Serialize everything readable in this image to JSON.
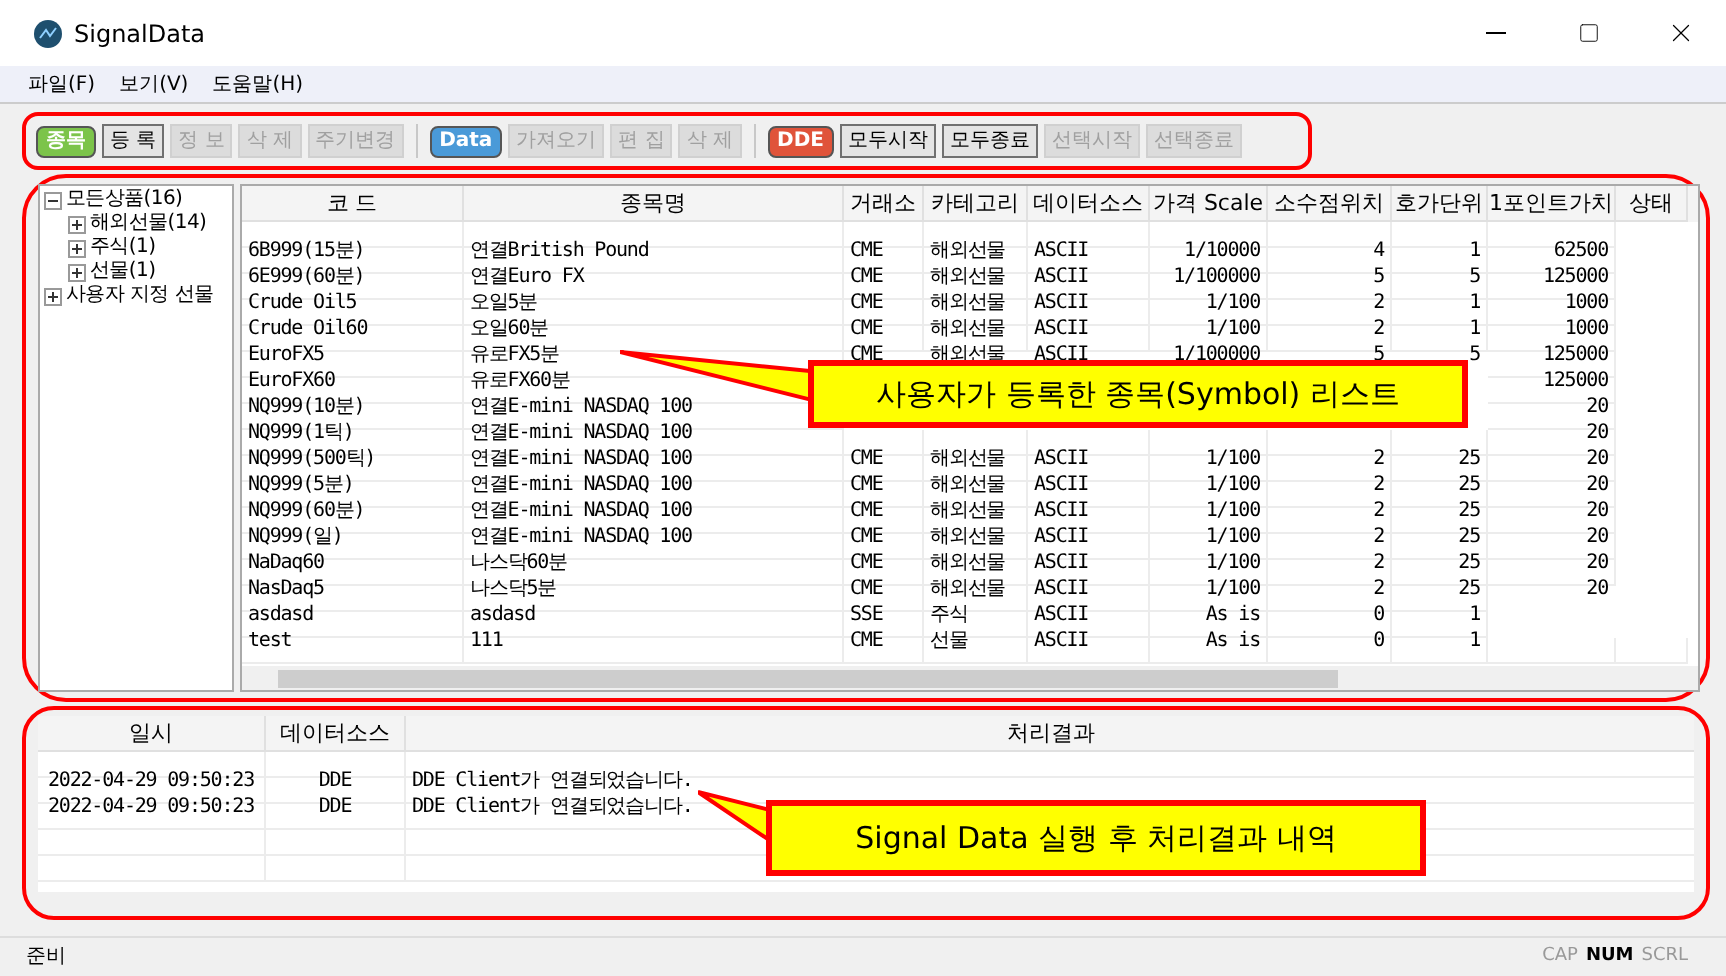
{
  "window": {
    "title": "SignalData"
  },
  "menu": [
    "파일(F)",
    "보기(V)",
    "도움말(H)"
  ],
  "toolbar": {
    "groups": [
      {
        "tag": {
          "label": "종목",
          "color": "#7cc44a"
        },
        "buttons": [
          {
            "label": "등 록",
            "disabled": false
          },
          {
            "label": "정 보",
            "disabled": true
          },
          {
            "label": "삭 제",
            "disabled": true
          },
          {
            "label": "주기변경",
            "disabled": true
          }
        ]
      },
      {
        "tag": {
          "label": "Data",
          "color": "#4a9ad8"
        },
        "buttons": [
          {
            "label": "가져오기",
            "disabled": true
          },
          {
            "label": "편 집",
            "disabled": true
          },
          {
            "label": "삭 제",
            "disabled": true
          }
        ]
      },
      {
        "tag": {
          "label": "DDE",
          "color": "#e0533a"
        },
        "buttons": [
          {
            "label": "모두시작",
            "disabled": false
          },
          {
            "label": "모두종료",
            "disabled": false
          },
          {
            "label": "선택시작",
            "disabled": true
          },
          {
            "label": "선택종료",
            "disabled": true
          }
        ]
      }
    ]
  },
  "tree": [
    {
      "label": "모든상품(16)",
      "expanded": true,
      "children": [
        {
          "label": "해외선물(14)",
          "expanded": false
        },
        {
          "label": "주식(1)",
          "expanded": false
        },
        {
          "label": "선물(1)",
          "expanded": false
        }
      ]
    },
    {
      "label": "사용자 지정 선물",
      "expanded": false
    }
  ],
  "symbol_table": {
    "columns": [
      "코 드",
      "종목명",
      "거래소",
      "카테고리",
      "데이터소스",
      "가격 Scale",
      "소수점위치",
      "호가단위",
      "1포인트가치",
      "상태"
    ],
    "rows": [
      [
        "6B999(15분)",
        "연결British Pound",
        "CME",
        "해외선물",
        "ASCII",
        "1/10000",
        "4",
        "1",
        "62500",
        null
      ],
      [
        "6E999(60분)",
        "연결Euro FX",
        "CME",
        "해외선물",
        "ASCII",
        "1/100000",
        "5",
        "5",
        "125000",
        null
      ],
      [
        "Crude Oil5",
        "오일5분",
        "CME",
        "해외선물",
        "ASCII",
        "1/100",
        "2",
        "1",
        "1000",
        null
      ],
      [
        "Crude Oil60",
        "오일60분",
        "CME",
        "해외선물",
        "ASCII",
        "1/100",
        "2",
        "1",
        "1000",
        null
      ],
      [
        "EuroFX5",
        "유로FX5분",
        "CME",
        "해외선물",
        "ASCII",
        "1/100000",
        "5",
        "5",
        "125000",
        null
      ],
      [
        "EuroFX60",
        "유로FX60분",
        null,
        null,
        null,
        null,
        null,
        null,
        "125000",
        null
      ],
      [
        "NQ999(10분)",
        "연결E-mini NASDAQ 100",
        null,
        null,
        null,
        null,
        null,
        null,
        "20",
        null
      ],
      [
        "NQ999(1틱)",
        "연결E-mini NASDAQ 100",
        null,
        null,
        null,
        null,
        null,
        null,
        "20",
        null
      ],
      [
        "NQ999(500틱)",
        "연결E-mini NASDAQ 100",
        "CME",
        "해외선물",
        "ASCII",
        "1/100",
        "2",
        "25",
        "20",
        null
      ],
      [
        "NQ999(5분)",
        "연결E-mini NASDAQ 100",
        "CME",
        "해외선물",
        "ASCII",
        "1/100",
        "2",
        "25",
        "20",
        null
      ],
      [
        "NQ999(60분)",
        "연결E-mini NASDAQ 100",
        "CME",
        "해외선물",
        "ASCII",
        "1/100",
        "2",
        "25",
        "20",
        null
      ],
      [
        "NQ999(일)",
        "연결E-mini NASDAQ 100",
        "CME",
        "해외선물",
        "ASCII",
        "1/100",
        "2",
        "25",
        "20",
        null
      ],
      [
        "NaDaq60",
        "나스닥60분",
        "CME",
        "해외선물",
        "ASCII",
        "1/100",
        "2",
        "25",
        "20",
        null
      ],
      [
        "NasDaq5",
        "나스닥5분",
        "CME",
        "해외선물",
        "ASCII",
        "1/100",
        "2",
        "25",
        "20",
        null
      ],
      [
        "asdasd",
        "asdasd",
        "SSE",
        "주식",
        "ASCII",
        "As is",
        "0",
        "1",
        null,
        null
      ],
      [
        "test",
        "111",
        "CME",
        "선물",
        "ASCII",
        "As is",
        "0",
        "1",
        null,
        null
      ]
    ]
  },
  "symbol_callout": "사용자가 등록한 종목(Symbol) 리스트",
  "log_table": {
    "columns": [
      "일시",
      "데이터소스",
      "처리결과"
    ],
    "rows": [
      [
        "2022-04-29 09:50:23",
        "DDE",
        "DDE Client가 연결되었습니다."
      ],
      [
        "2022-04-29 09:50:23",
        "DDE",
        "DDE Client가 연결되었습니다."
      ]
    ]
  },
  "log_callout": "Signal Data 실행 후 처리결과 내역",
  "status_bar": {
    "text": "준비",
    "indicators": [
      {
        "label": "CAP",
        "on": false
      },
      {
        "label": "NUM",
        "on": true
      },
      {
        "label": "SCRL",
        "on": false
      }
    ]
  }
}
